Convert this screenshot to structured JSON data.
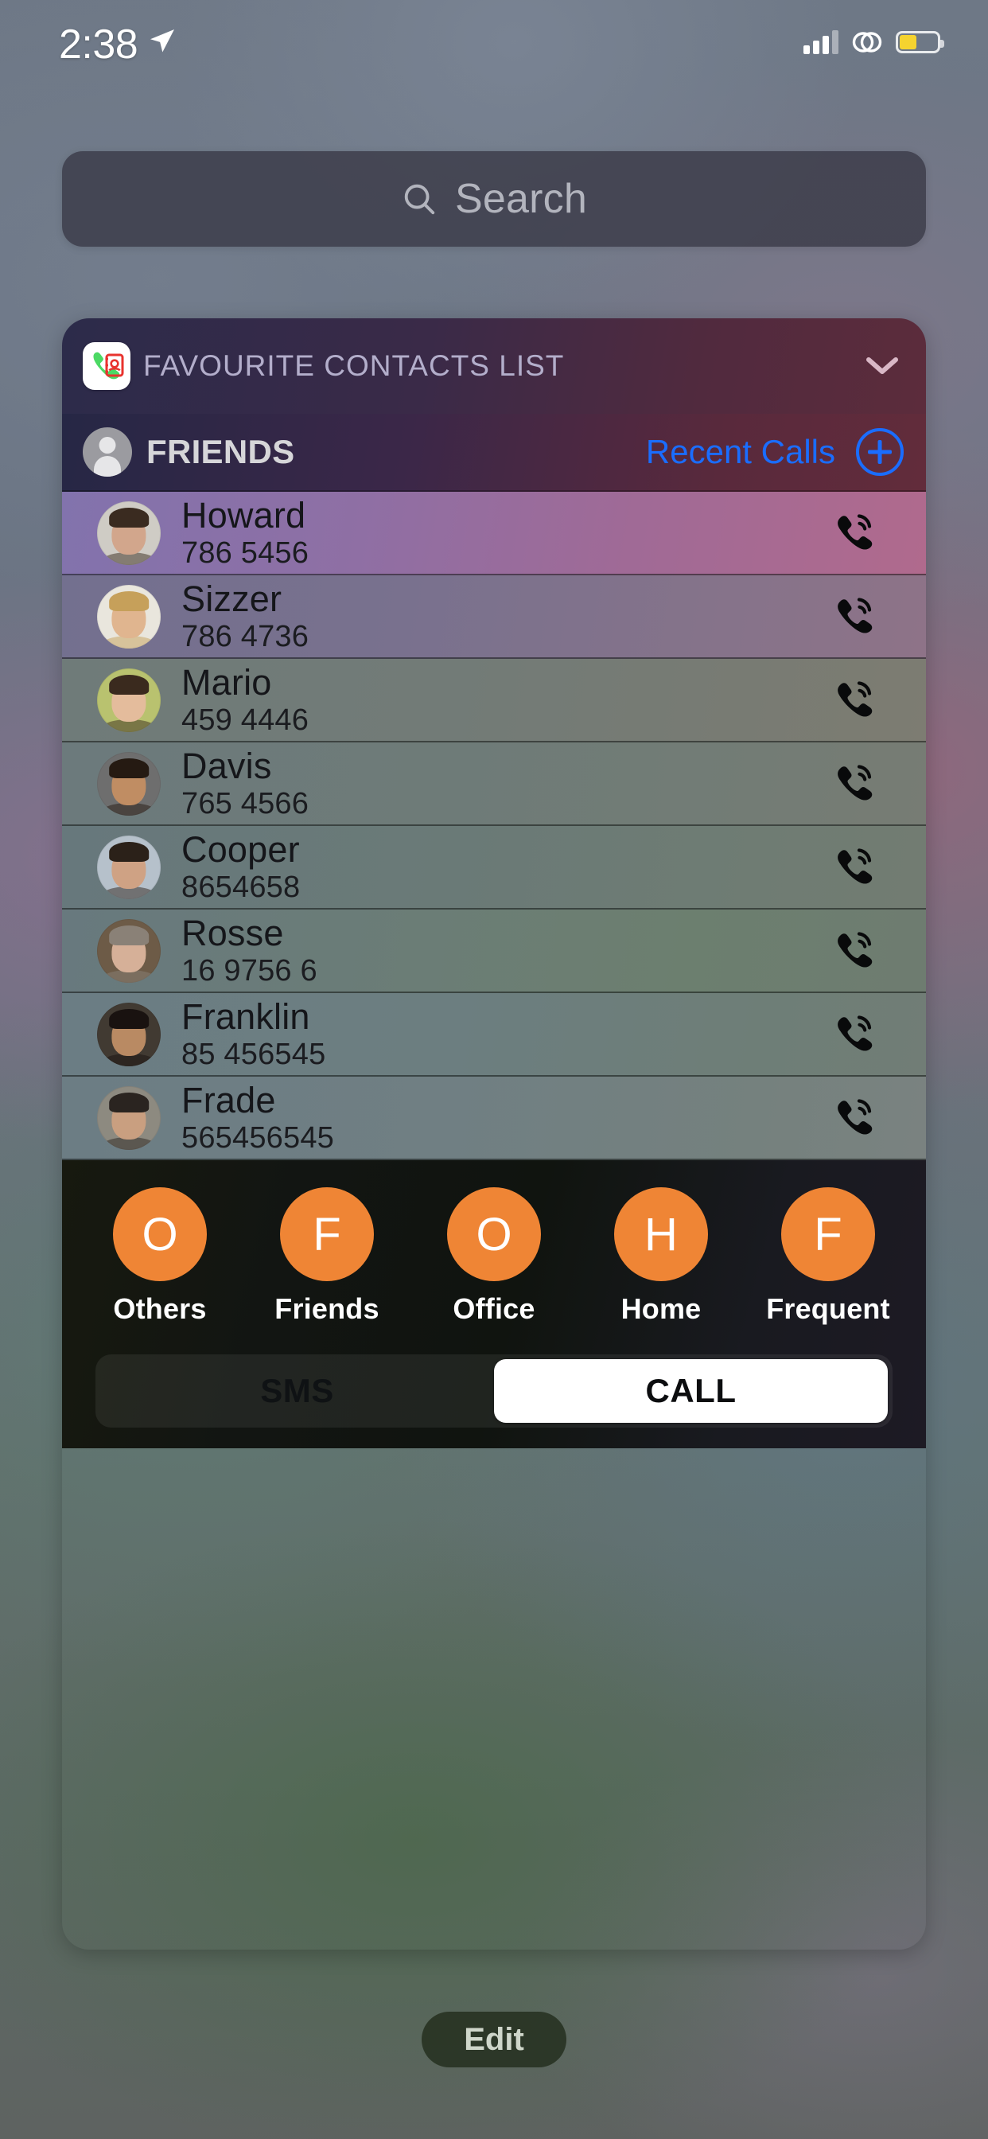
{
  "status_bar": {
    "time": "2:38",
    "location_icon": "location-arrow-icon",
    "signal_icon": "cellular-signal-icon",
    "link_icon": "chain-link-icon",
    "battery_icon": "battery-low-power-icon",
    "battery_level_percent": 46
  },
  "search": {
    "placeholder": "Search",
    "icon": "search-icon"
  },
  "widget": {
    "app_icon": "phone-contacts-app-icon",
    "title": "FAVOURITE CONTACTS LIST",
    "collapse_icon": "chevron-down-icon",
    "group": {
      "avatar_icon": "person-avatar-icon",
      "label": "FRIENDS",
      "recent_calls_label": "Recent Calls",
      "add_icon": "plus-circle-icon"
    },
    "contacts": [
      {
        "name": "Howard",
        "number": "786 5456",
        "call_icon": "phone-call-icon"
      },
      {
        "name": "Sizzer",
        "number": "786 4736",
        "call_icon": "phone-call-icon"
      },
      {
        "name": "Mario",
        "number": "459 4446",
        "call_icon": "phone-call-icon"
      },
      {
        "name": "Davis",
        "number": "765 4566",
        "call_icon": "phone-call-icon"
      },
      {
        "name": "Cooper",
        "number": "8654658",
        "call_icon": "phone-call-icon"
      },
      {
        "name": "Rosse",
        "number": "16 9756 6",
        "call_icon": "phone-call-icon"
      },
      {
        "name": "Franklin",
        "number": "85 456545",
        "call_icon": "phone-call-icon"
      },
      {
        "name": "Frade",
        "number": "565456545",
        "call_icon": "phone-call-icon"
      }
    ],
    "categories": [
      {
        "initial": "O",
        "label": "Others"
      },
      {
        "initial": "F",
        "label": "Friends"
      },
      {
        "initial": "O",
        "label": "Office"
      },
      {
        "initial": "H",
        "label": "Home"
      },
      {
        "initial": "F",
        "label": "Frequent"
      }
    ],
    "actions": {
      "sms_label": "SMS",
      "call_label": "CALL",
      "selected": "CALL"
    }
  },
  "edit_button": {
    "label": "Edit"
  },
  "colors": {
    "accent_blue": "#1a6dff",
    "category_orange": "#ef8535",
    "battery_yellow": "#f5d32f",
    "widget_title_text": "#b3aecb",
    "search_placeholder": "#b2b4bd"
  }
}
